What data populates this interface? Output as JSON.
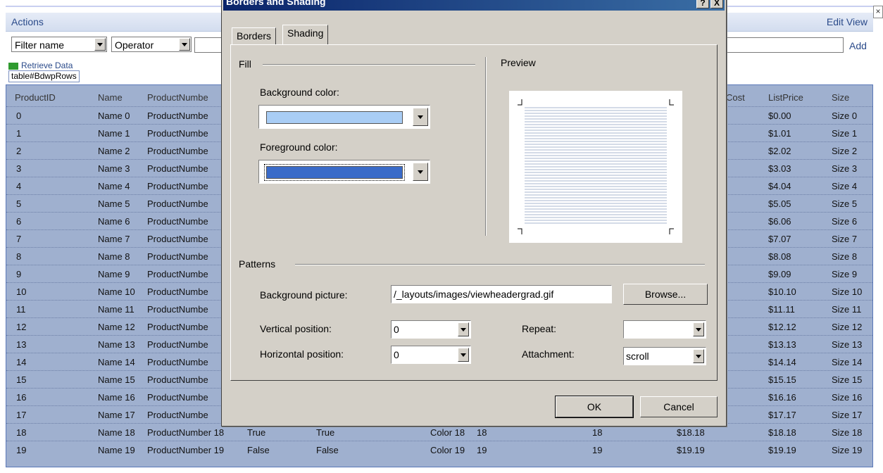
{
  "page": {
    "actions_label": "Actions",
    "edit_view_label": "Edit View",
    "filter_name": "Filter name",
    "operator": "Operator",
    "add_label": "Add",
    "retrieve_data": "Retrieve Data",
    "element_tag": "table#BdwpRows"
  },
  "table": {
    "headers": [
      "ProductID",
      "Name",
      "ProductNumbe",
      "Cost",
      "ListPrice",
      "Size"
    ],
    "rows": [
      {
        "id": "0",
        "name": "Name 0",
        "num": "ProductNumbe",
        "list": "$0.00",
        "size": "Size 0"
      },
      {
        "id": "1",
        "name": "Name 1",
        "num": "ProductNumbe",
        "list": "$1.01",
        "size": "Size 1"
      },
      {
        "id": "2",
        "name": "Name 2",
        "num": "ProductNumbe",
        "list": "$2.02",
        "size": "Size 2"
      },
      {
        "id": "3",
        "name": "Name 3",
        "num": "ProductNumbe",
        "list": "$3.03",
        "size": "Size 3"
      },
      {
        "id": "4",
        "name": "Name 4",
        "num": "ProductNumbe",
        "list": "$4.04",
        "size": "Size 4"
      },
      {
        "id": "5",
        "name": "Name 5",
        "num": "ProductNumbe",
        "list": "$5.05",
        "size": "Size 5"
      },
      {
        "id": "6",
        "name": "Name 6",
        "num": "ProductNumbe",
        "list": "$6.06",
        "size": "Size 6"
      },
      {
        "id": "7",
        "name": "Name 7",
        "num": "ProductNumbe",
        "list": "$7.07",
        "size": "Size 7"
      },
      {
        "id": "8",
        "name": "Name 8",
        "num": "ProductNumbe",
        "list": "$8.08",
        "size": "Size 8"
      },
      {
        "id": "9",
        "name": "Name 9",
        "num": "ProductNumbe",
        "list": "$9.09",
        "size": "Size 9"
      },
      {
        "id": "10",
        "name": "Name 10",
        "num": "ProductNumbe",
        "list": "$10.10",
        "size": "Size 10"
      },
      {
        "id": "11",
        "name": "Name 11",
        "num": "ProductNumbe",
        "list": "$11.11",
        "size": "Size 11"
      },
      {
        "id": "12",
        "name": "Name 12",
        "num": "ProductNumbe",
        "list": "$12.12",
        "size": "Size 12"
      },
      {
        "id": "13",
        "name": "Name 13",
        "num": "ProductNumbe",
        "list": "$13.13",
        "size": "Size 13"
      },
      {
        "id": "14",
        "name": "Name 14",
        "num": "ProductNumbe",
        "list": "$14.14",
        "size": "Size 14"
      },
      {
        "id": "15",
        "name": "Name 15",
        "num": "ProductNumbe",
        "list": "$15.15",
        "size": "Size 15"
      },
      {
        "id": "16",
        "name": "Name 16",
        "num": "ProductNumbe",
        "list": "$16.16",
        "size": "Size 16"
      },
      {
        "id": "17",
        "name": "Name 17",
        "num": "ProductNumbe",
        "list": "$17.17",
        "size": "Size 17"
      }
    ],
    "full_rows": [
      {
        "id": "18",
        "name": "Name 18",
        "num": "ProductNumber 18",
        "b1": "True",
        "b2": "True",
        "color": "Color 18",
        "c1": "18",
        "c2": "18",
        "cost": "$18.18",
        "list": "$18.18",
        "size": "Size 18"
      },
      {
        "id": "19",
        "name": "Name 19",
        "num": "ProductNumber 19",
        "b1": "False",
        "b2": "False",
        "color": "Color 19",
        "c1": "19",
        "c2": "19",
        "cost": "$19.19",
        "list": "$19.19",
        "size": "Size 19"
      }
    ]
  },
  "dialog": {
    "title": "Borders and Shading",
    "help_btn": "?",
    "close_btn": "X",
    "tabs": [
      "Borders",
      "Shading"
    ],
    "fill_label": "Fill",
    "preview_label": "Preview",
    "bg_color_label": "Background color:",
    "bg_color_value": "#a9cdf5",
    "fg_color_label": "Foreground color:",
    "fg_color_value": "#3a6bc9",
    "patterns_label": "Patterns",
    "bg_picture_label": "Background picture:",
    "bg_picture_value": "/_layouts/images/viewheadergrad.gif",
    "browse_btn": "Browse...",
    "vertical_label": "Vertical position:",
    "vertical_value": "0",
    "horizontal_label": "Horizontal position:",
    "horizontal_value": "0",
    "repeat_label": "Repeat:",
    "repeat_value": "",
    "attachment_label": "Attachment:",
    "attachment_value": "scroll",
    "ok_btn": "OK",
    "cancel_btn": "Cancel"
  }
}
